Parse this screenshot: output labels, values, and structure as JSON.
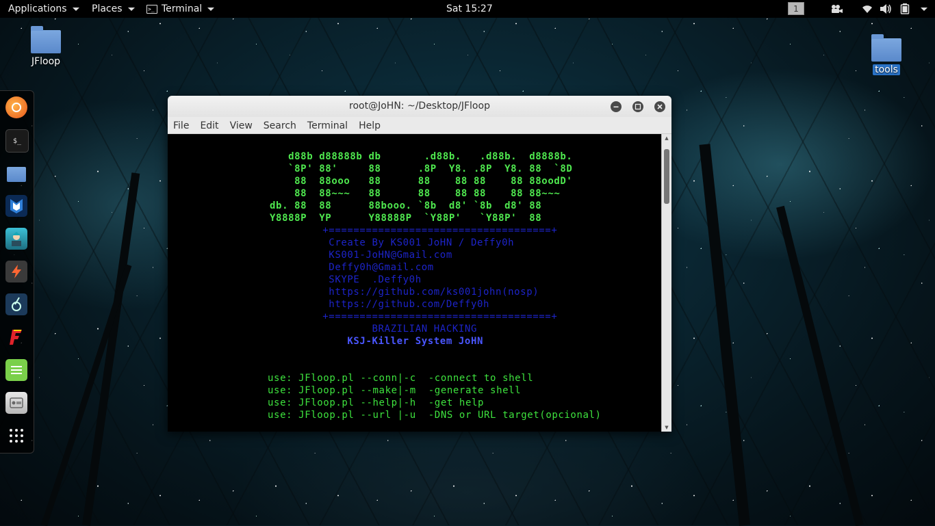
{
  "top_panel": {
    "applications": "Applications",
    "places": "Places",
    "terminal": "Terminal",
    "clock": "Sat 15:27",
    "workspace": "1"
  },
  "desktop": {
    "icons": [
      {
        "label": "JFloop"
      },
      {
        "label": "tools"
      }
    ]
  },
  "dock": {
    "items": [
      "firefox-icon",
      "terminal-icon",
      "files-icon",
      "metasploit-icon",
      "armitage-icon",
      "burpsuite-icon",
      "beef-icon",
      "faraday-icon",
      "leafpad-icon",
      "cutycapt-icon",
      "show-apps-icon"
    ]
  },
  "window": {
    "title": "root@JoHN: ~/Desktop/JFloop",
    "menu": [
      "File",
      "Edit",
      "View",
      "Search",
      "Terminal",
      "Help"
    ]
  },
  "terminal": {
    "banner": [
      "    d88b d88888b db       .d88b.   .d88b.  d8888b.",
      "    `8P' 88'     88      .8P  Y8. .8P  Y8. 88  `8D",
      "     88  88ooo   88      88    88 88    88 88oodD'",
      "     88  88~~~   88      88    88 88    88 88~~~",
      " db. 88  88      88booo. `8b  d8' `8b  d8' 88",
      " Y8888P  YP      Y88888P  `Y88P'   `Y88P'  88"
    ],
    "credits": [
      "         +====================================+",
      "          Create By KS001 JoHN / Deffy0h",
      "          KS001-JoHN@Gmail.com",
      "          Deffy0h@Gmail.com",
      "          SKYPE  .Deffy0h",
      "          https://github.com/ks001john(nosp)",
      "          https://github.com/Deffy0h",
      "         +====================================+",
      "                 BRAZILIAN HACKING"
    ],
    "tagline": "             KSJ-Killer System JoHN",
    "usage": [
      " use: JFloop.pl --conn|-c  -connect to shell",
      " use: JFloop.pl --make|-m  -generate shell",
      " use: JFloop.pl --help|-h  -get help",
      " use: JFloop.pl --url |-u  -DNS or URL target(opcional)"
    ]
  },
  "colors": {
    "banner": "#4fe84f",
    "credits": "#1d24c9",
    "tagline": "#4a56ff",
    "usage": "#3ee23e"
  }
}
